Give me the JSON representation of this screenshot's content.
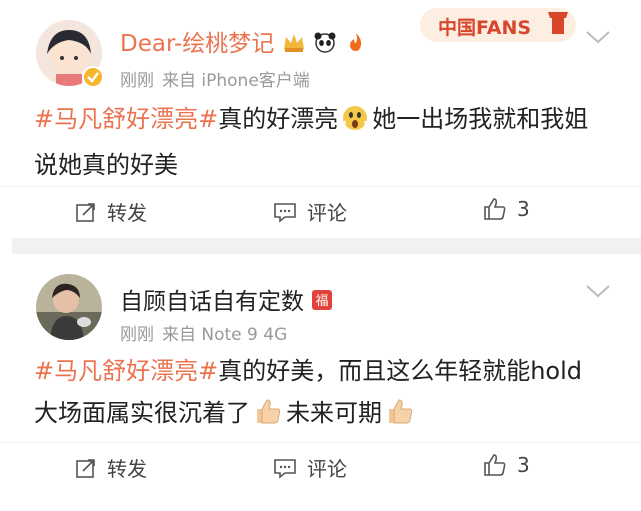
{
  "posts": [
    {
      "username": "Dear-绘桃梦记",
      "time": "刚刚",
      "source": "来自 iPhone客户端",
      "hashtag": "#马凡舒好漂亮#",
      "text_1": "真的好漂亮",
      "text_2": "她一出场我就和我姐说她真的好美",
      "banner": "中国FANS",
      "actions": {
        "repost": "转发",
        "comment": "评论",
        "like_count": "3"
      }
    },
    {
      "username": "自顾自话自有定数",
      "time": "刚刚",
      "source": "来自 Note 9 4G",
      "hashtag": "#马凡舒好漂亮#",
      "text_1": "真的好美，而且这么年轻就能hold大场面属实很沉着了",
      "text_2": "未来可期",
      "badge_char": "福",
      "actions": {
        "repost": "转发",
        "comment": "评论",
        "like_count": "3"
      }
    }
  ],
  "colors": {
    "hashtag": "#eb7350",
    "username_vip": "#eb7350",
    "meta": "#999999"
  }
}
